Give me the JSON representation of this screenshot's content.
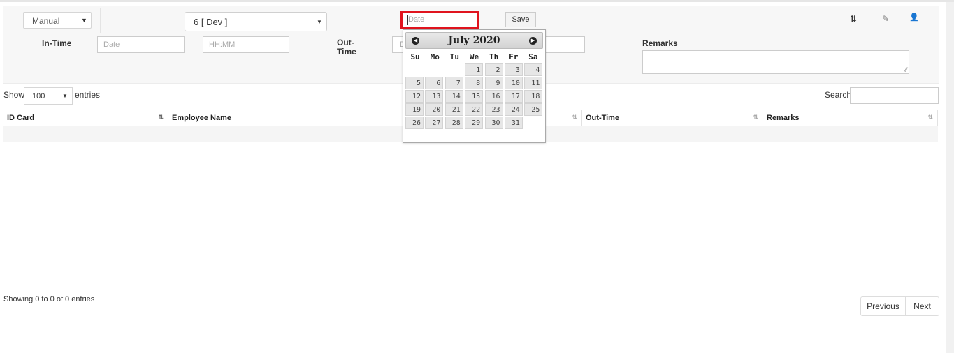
{
  "form": {
    "mode_select": "Manual",
    "employee_select": "6 [ Dev ]",
    "date_placeholder": "Date",
    "save_label": "Save",
    "in_time_label": "In-Time",
    "in_date_placeholder": "Date",
    "in_time_placeholder": "HH:MM",
    "out_time_label": "Out-\nTime",
    "out_date_placeholder": "D",
    "remarks_label": "Remarks"
  },
  "toolbar": {
    "icons": [
      "sort-icon",
      "edit-icon",
      "user-icon"
    ],
    "sort_glyph": "⇅",
    "edit_glyph": "✎",
    "user_glyph": "👤"
  },
  "table_controls": {
    "show_label": "Show",
    "entries_value": "100",
    "entries_label": "entries",
    "search_label": "Search:"
  },
  "table": {
    "columns": [
      "ID Card",
      "Employee Name",
      "",
      "Out-Time",
      "Remarks"
    ]
  },
  "calendar": {
    "title": "July 2020",
    "prev_glyph": "◀",
    "next_glyph": "▶",
    "weekdays": [
      "Su",
      "Mo",
      "Tu",
      "We",
      "Th",
      "Fr",
      "Sa"
    ],
    "days": [
      "",
      "",
      "",
      "1",
      "2",
      "3",
      "4",
      "5",
      "6",
      "7",
      "8",
      "9",
      "10",
      "11",
      "12",
      "13",
      "14",
      "15",
      "16",
      "17",
      "18",
      "19",
      "20",
      "21",
      "22",
      "23",
      "24",
      "25",
      "26",
      "27",
      "28",
      "29",
      "30",
      "31",
      ""
    ]
  },
  "footer": {
    "info": "Showing 0 to 0 of 0 entries",
    "previous_label": "Previous",
    "next_label": "Next"
  },
  "colors": {
    "highlight_border": "#e0141e",
    "panel_bg": "#f7f7f7"
  }
}
